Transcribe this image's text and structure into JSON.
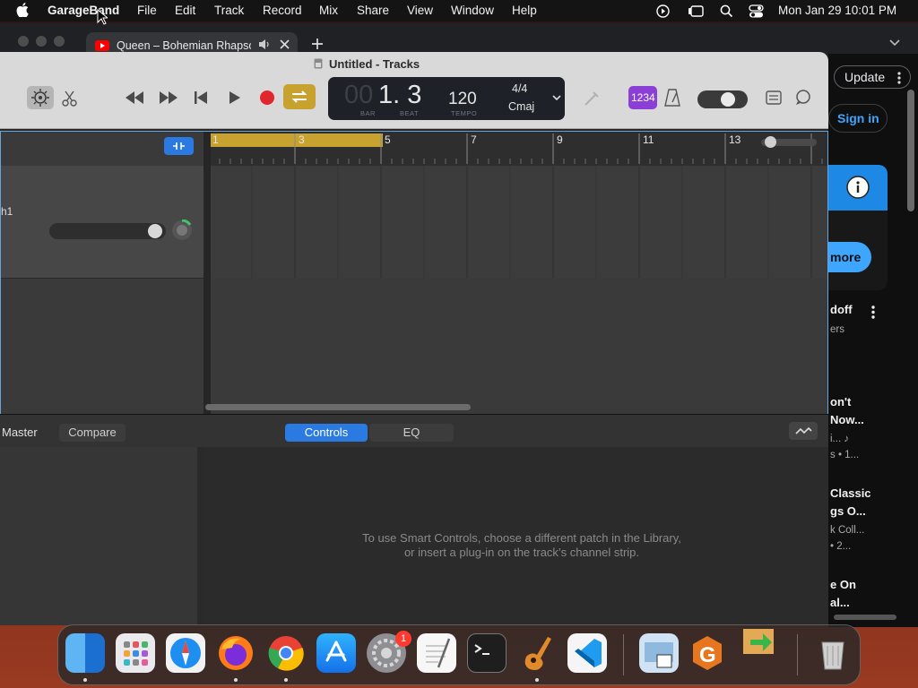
{
  "menubar": {
    "app_name": "GarageBand",
    "items": [
      "File",
      "Edit",
      "Track",
      "Record",
      "Mix",
      "Share",
      "View",
      "Window",
      "Help"
    ],
    "clock": "Mon Jan 29  10:01 PM"
  },
  "browser": {
    "tab_title": "Queen – Bohemian Rhapsody",
    "update_label": "Update",
    "sign_in_label": "Sign in",
    "more_label": "more",
    "sidebar_text": [
      {
        "title": "doff",
        "sub": "ers"
      },
      {
        "title": "on't",
        "sub": ""
      },
      {
        "title": "Now...",
        "sub": "i...  ♪"
      },
      {
        "title": "",
        "sub": "s • 1..."
      },
      {
        "title": "Classic",
        "sub": ""
      },
      {
        "title": "gs O...",
        "sub": "k Coll..."
      },
      {
        "title": "",
        "sub": "• 2..."
      },
      {
        "title": "e On",
        "sub": ""
      },
      {
        "title": "al...",
        "sub": ""
      }
    ]
  },
  "garageband": {
    "window_title": "Untitled - Tracks",
    "lcd": {
      "bar_dim": "00",
      "position": "1. 3",
      "bar_label": "BAR",
      "beat_label": "BEAT",
      "tempo": "120",
      "tempo_label": "TEMPO",
      "signature": "4/4",
      "key": "Cmaj"
    },
    "count_in": "1234",
    "ruler_numbers": [
      "1",
      "3",
      "5",
      "7",
      "9",
      "11",
      "13"
    ],
    "track_name_fragment": "h1",
    "smart_controls": {
      "master_label": "Master",
      "compare_label": "Compare",
      "controls_tab": "Controls",
      "eq_tab": "EQ",
      "message_line1": "To use Smart Controls, choose a different patch in the Library,",
      "message_line2": "or insert a plug-in on the track’s channel strip."
    }
  },
  "dock": {
    "apps": [
      "Finder",
      "Launchpad",
      "Safari",
      "Firefox",
      "Chrome",
      "App Store",
      "System Settings",
      "TextEdit",
      "Terminal",
      "GarageBand",
      "Visual Studio Code",
      "Preview",
      "Grammarly",
      "Migration",
      "Trash"
    ],
    "settings_badge": "1"
  },
  "colors": {
    "accent_blue": "#2a7ae2",
    "cycle_gold": "#c8a22f",
    "record_red": "#e0262f",
    "count_in_purple": "#8b3fd6"
  }
}
